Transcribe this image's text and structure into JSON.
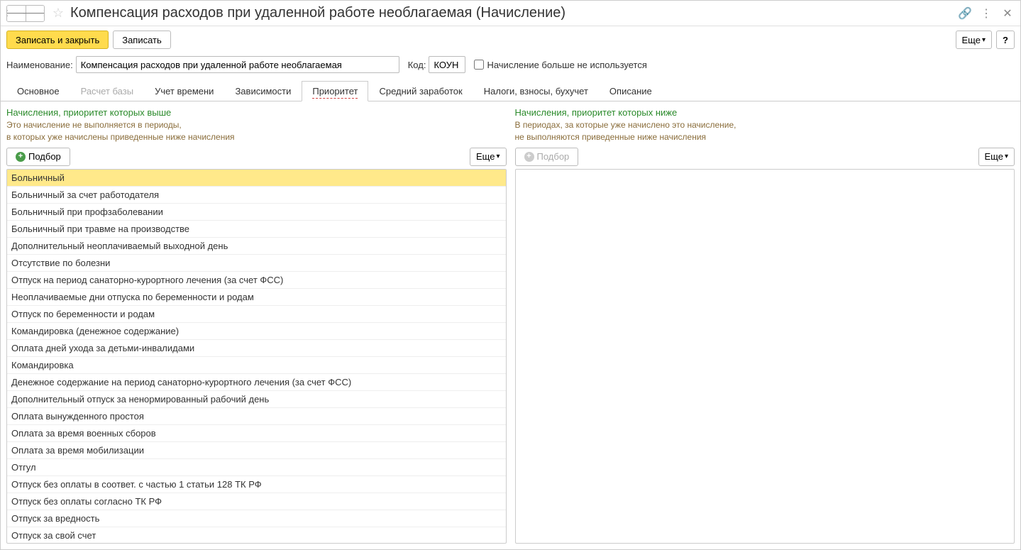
{
  "title": "Компенсация расходов при удаленной работе необлагаемая (Начисление)",
  "toolbar": {
    "save_close": "Записать и закрыть",
    "save": "Записать",
    "more": "Еще",
    "help": "?"
  },
  "form": {
    "name_label": "Наименование:",
    "name_value": "Компенсация расходов при удаленной работе необлагаемая",
    "code_label": "Код:",
    "code_value": "КОУН",
    "not_used_label": "Начисление больше не используется"
  },
  "tabs": [
    {
      "label": "Основное"
    },
    {
      "label": "Расчет базы",
      "disabled": true
    },
    {
      "label": "Учет времени"
    },
    {
      "label": "Зависимости"
    },
    {
      "label": "Приоритет",
      "active": true
    },
    {
      "label": "Средний заработок"
    },
    {
      "label": "Налоги, взносы, бухучет"
    },
    {
      "label": "Описание"
    }
  ],
  "left_panel": {
    "title": "Начисления, приоритет которых выше",
    "desc_line1": "Это начисление не выполняется в периоды,",
    "desc_line2": "в которых уже начислены приведенные ниже начисления",
    "add_btn": "Подбор",
    "more_btn": "Еще",
    "items": [
      "Больничный",
      "Больничный за счет работодателя",
      "Больничный при профзаболевании",
      "Больничный при травме на производстве",
      "Дополнительный неоплачиваемый выходной день",
      "Отсутствие по болезни",
      "Отпуск на период санаторно-курортного лечения (за счет ФСС)",
      "Неоплачиваемые дни отпуска по беременности и родам",
      "Отпуск по беременности и родам",
      "Командировка (денежное содержание)",
      "Оплата дней ухода за детьми-инвалидами",
      "Командировка",
      "Денежное содержание на период санаторно-курортного лечения (за счет ФСС)",
      "Дополнительный отпуск за ненормированный рабочий день",
      "Оплата вынужденного простоя",
      "Оплата за время военных сборов",
      "Оплата за время мобилизации",
      "Отгул",
      "Отпуск без оплаты в соответ. с частью 1 статьи 128 ТК РФ",
      "Отпуск без оплаты согласно ТК РФ",
      "Отпуск за вредность",
      "Отпуск за свой счет"
    ]
  },
  "right_panel": {
    "title": "Начисления, приоритет которых ниже",
    "desc_line1": "В периодах, за которые уже начислено это начисление,",
    "desc_line2": "не выполняются приведенные ниже начисления",
    "add_btn": "Подбор",
    "more_btn": "Еще",
    "items": []
  }
}
